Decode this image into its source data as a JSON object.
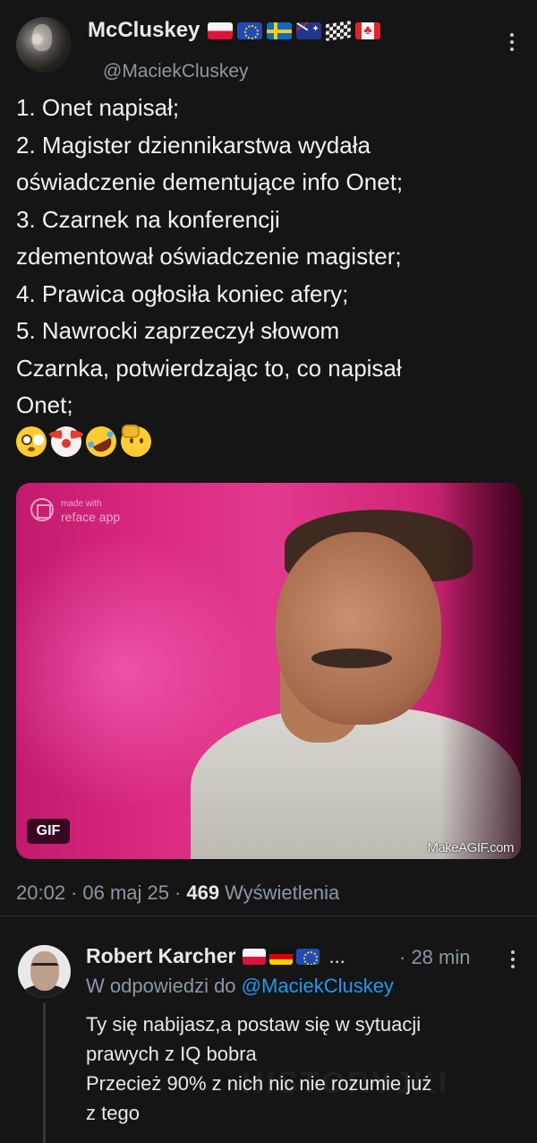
{
  "tweet": {
    "display_name": "McCluskey",
    "handle": "@MaciekCluskey",
    "name_flags": [
      "poland-flag",
      "eu-flag",
      "sweden-flag",
      "australia-flag",
      "checkered-flag",
      "canada-flag"
    ],
    "lines": [
      "1. Onet napisał;",
      "2. Magister dziennikarstwa wydała",
      "oświadczenie dementujące info Onet;",
      "3. Czarnek na konferencji",
      "zdementował oświadczenie magister;",
      "4. Prawica ogłosiła koniec afery;",
      "5. Nawrocki zaprzeczył słowom",
      "Czarnka, potwierdzając to, co napisał",
      "Onet;"
    ],
    "emojis": [
      "flushed-face-emoji",
      "clown-face-emoji",
      "rolling-laughing-emoji",
      "saluting-face-emoji"
    ],
    "media": {
      "badge": "GIF",
      "watermark_top_line1": "made with",
      "watermark_top_line2": "reface app",
      "watermark_bottom": "MakeAGIF.com"
    },
    "time": "20:02",
    "date": "06 maj 25",
    "views_count": "469",
    "views_label": "Wyświetlenia",
    "separator": "·"
  },
  "reply": {
    "display_name": "Robert Karcher",
    "name_flags": [
      "poland-flag",
      "germany-flag",
      "eu-flag"
    ],
    "truncation": "...",
    "time": "· 28 min",
    "reply_prefix": "W odpowiedzi do",
    "reply_mention": "@MaciekCluskey",
    "lines": [
      "Ty się nabijasz,a postaw się w sytuacji",
      "prawych z IQ bobra",
      "Przecież 90% z nich nic nie rozumie już",
      "z tego"
    ]
  },
  "site_watermark": "HISTORYJKI"
}
